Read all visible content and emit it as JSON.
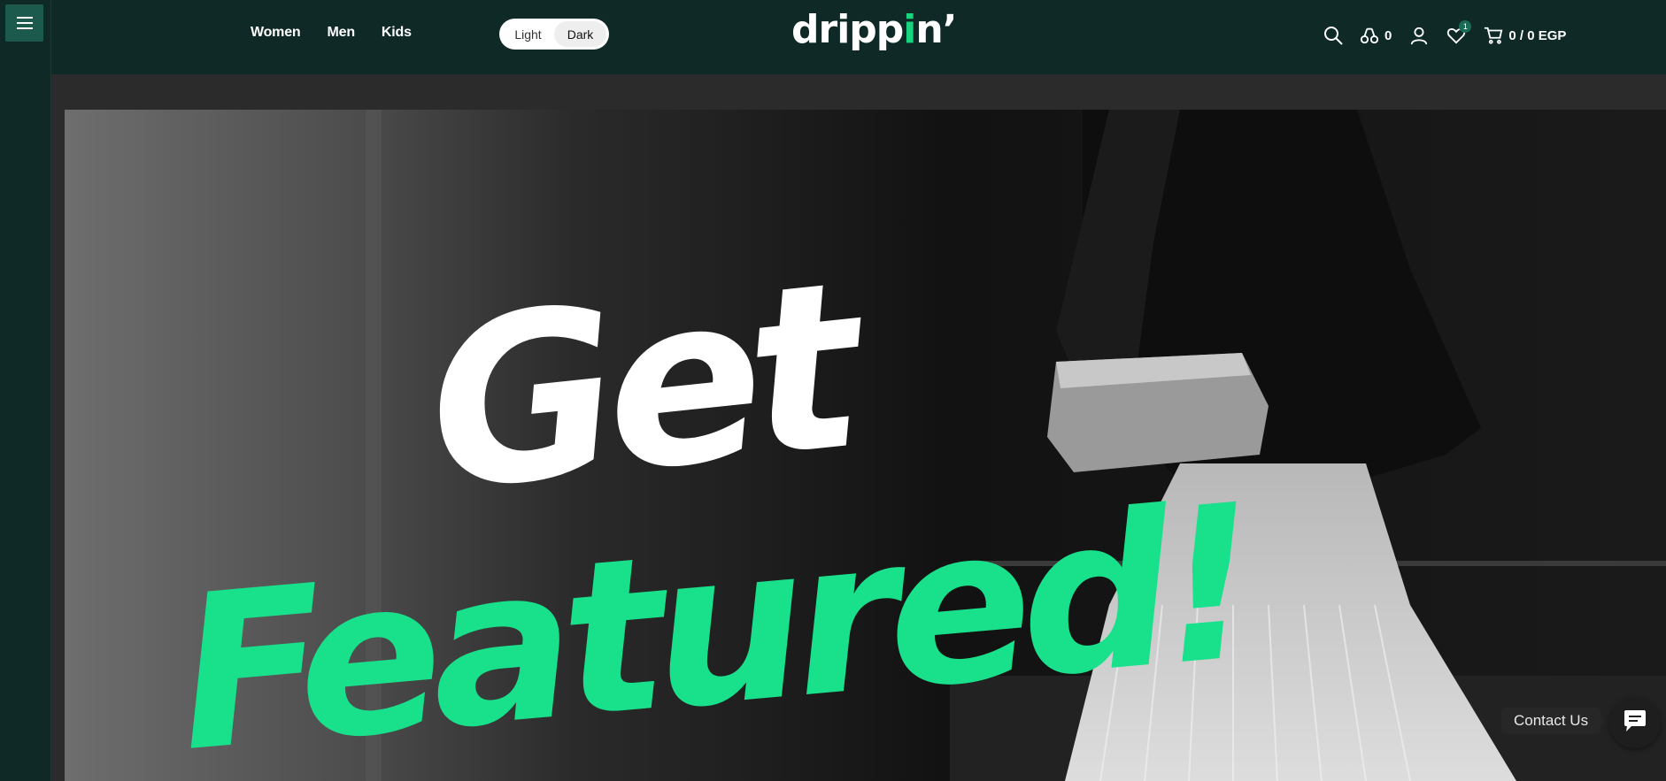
{
  "header": {
    "nav": [
      {
        "label": "Women"
      },
      {
        "label": "Men"
      },
      {
        "label": "Kids"
      }
    ],
    "theme_toggle": {
      "light_label": "Light",
      "dark_label": "Dark",
      "selected": "Dark"
    },
    "logo": {
      "text_before": "dripp",
      "text_dot": "i",
      "text_after": "n’"
    },
    "compare_count": "0",
    "wishlist_badge": "1",
    "cart_summary": "0 / 0 EGP"
  },
  "hero": {
    "line1": "Get",
    "line2": "Featured!"
  },
  "contact": {
    "label": "Contact Us"
  },
  "colors": {
    "header_bg": "#0f2a26",
    "accent_green": "#19e08a",
    "menu_button_bg": "#1b5a4c"
  },
  "icons": [
    "menu-icon",
    "search-icon",
    "compare-icon",
    "user-icon",
    "heart-icon",
    "cart-icon",
    "chat-icon"
  ]
}
